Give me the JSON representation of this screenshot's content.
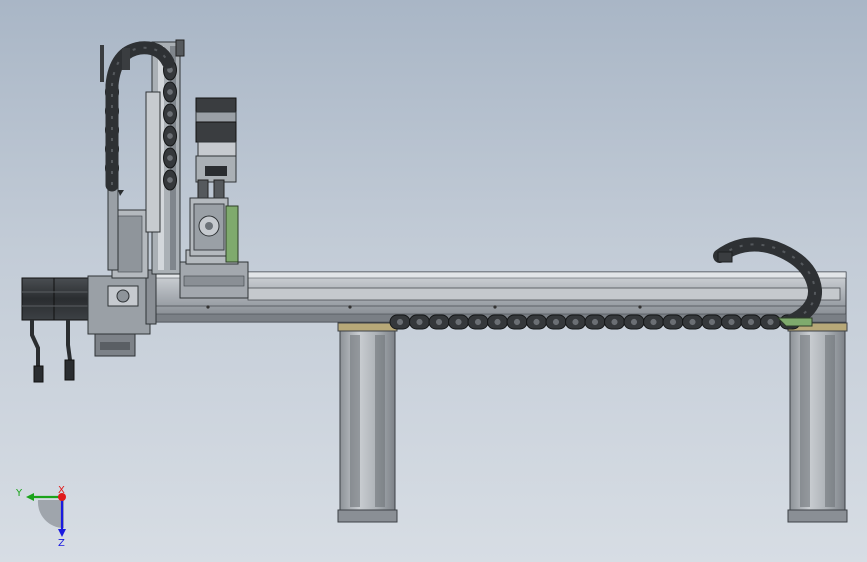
{
  "triad": {
    "x_label": "X",
    "y_label": "Y",
    "z_label": "Z",
    "x_color": "#e01b1b",
    "y_color": "#1aa31a",
    "z_color": "#1a1ae0"
  },
  "palette": {
    "background_top": "#a9b6c6",
    "background_bottom": "#d7dde4",
    "metal": "#b9bec4",
    "metal_dark": "#6d7379",
    "motor": "#2d3033",
    "cable_chain": "#3a3d40",
    "bracket_green": "#7faa6d",
    "pad_tan": "#b7a878"
  }
}
